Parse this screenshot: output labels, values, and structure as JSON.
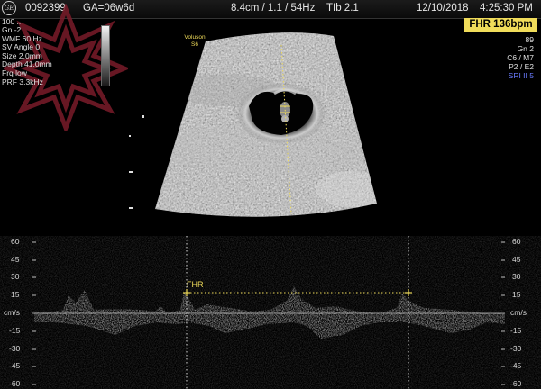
{
  "header": {
    "logo": "GE",
    "patient_id": "0092399",
    "ga": "GA=06w6d",
    "scan_params": "8.4cm / 1.1 / 54Hz",
    "tib": "TIb  2.1",
    "date": "12/10/2018",
    "time": "4:25:30 PM"
  },
  "fhr_badge": "FHR 136bpm",
  "left_params": [
    "100 ..",
    "Gn  -2",
    "WMF 60 Hz",
    "SV Angle  0",
    "Size  2.0mm",
    "Depth 41.0mm",
    "Frq low",
    "PRF  3.3kHz"
  ],
  "right_params": [
    "89",
    "Gn  2",
    "C6 / M7",
    "P2 / E2"
  ],
  "right_params_blue": "SRI II 5",
  "probe": {
    "line1": "Voluson",
    "line2": "S6"
  },
  "doppler": {
    "unit": "cm/s",
    "scale_left": [
      "60",
      "45",
      "30",
      "15",
      "-15",
      "-30",
      "-45",
      "-60"
    ],
    "scale_right": [
      "60",
      "45",
      "30",
      "15",
      "-15",
      "-30",
      "-45",
      "-60"
    ],
    "fhr_label": "FHR"
  },
  "colors": {
    "badge": "#f0dc5a",
    "caliper": "#f0dc5a",
    "blue_text": "#6a7cff",
    "watermark": "#7a1c2a"
  }
}
